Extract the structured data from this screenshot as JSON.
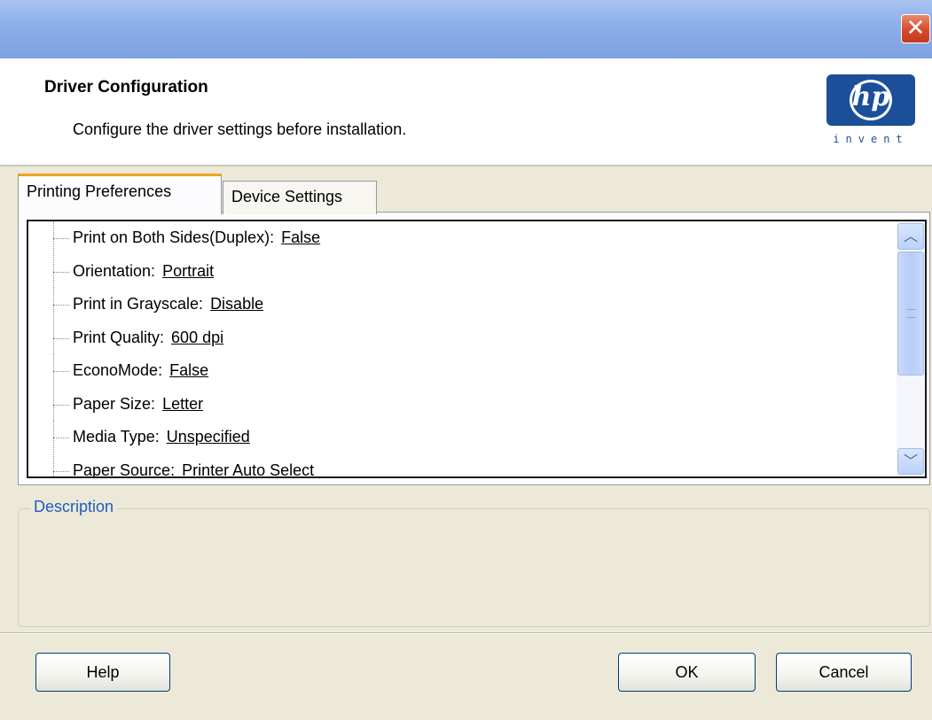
{
  "window": {
    "close_glyph": "✕",
    "header_title": "Driver Configuration",
    "header_subtitle": "Configure the driver settings before installation."
  },
  "logo": {
    "brand": "hp",
    "tagline": "invent",
    "color": "#1b4f9a"
  },
  "tabs": [
    {
      "label": "Printing Preferences",
      "active": true
    },
    {
      "label": "Device Settings",
      "active": false
    }
  ],
  "settings": [
    {
      "label": "Print on Both Sides(Duplex):",
      "value": "False"
    },
    {
      "label": "Orientation:",
      "value": "Portrait"
    },
    {
      "label": "Print in Grayscale:",
      "value": "Disable"
    },
    {
      "label": "Print Quality:",
      "value": "600 dpi"
    },
    {
      "label": "EconoMode:",
      "value": "False"
    },
    {
      "label": "Paper Size:",
      "value": "Letter"
    },
    {
      "label": "Media Type:",
      "value": "Unspecified"
    },
    {
      "label": "Paper Source:",
      "value": "Printer Auto Select"
    }
  ],
  "scrollbar": {
    "up_glyph": "︿",
    "down_glyph": "﹀"
  },
  "description": {
    "label": "Description",
    "text": ""
  },
  "buttons": {
    "help": "Help",
    "ok": "OK",
    "cancel": "Cancel"
  },
  "colors": {
    "accent_tab": "#f0a21e",
    "group_label": "#1f5cc4",
    "close_button": "#d7492b"
  }
}
